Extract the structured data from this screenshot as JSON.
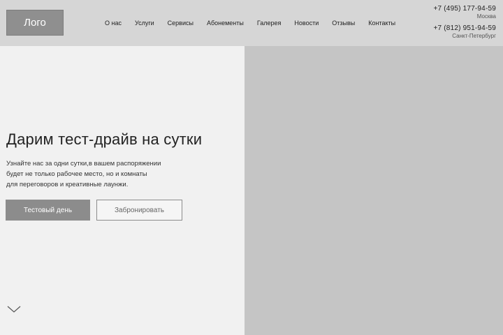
{
  "header": {
    "logo": "Лого",
    "nav": [
      "О нас",
      "Услуги",
      "Сервисы",
      "Абонементы",
      "Галерея",
      "Новости",
      "Отзывы",
      "Контакты"
    ],
    "contacts": [
      {
        "phone": "+7 (495) 177-94-59",
        "city": "Москва"
      },
      {
        "phone": "+7 (812) 951-94-59",
        "city": "Санкт-Петербург"
      }
    ]
  },
  "hero": {
    "title": "Дарим тест-драйв на сутки",
    "text_lines": [
      "Узнайте нас за одни сутки,в вашем распоряжении",
      "будет не только рабочее место, но и комнаты",
      "для переговоров и креативные лаунжи."
    ],
    "primary_button": "Тестовый день",
    "secondary_button": "Забронировать"
  },
  "icons": {
    "scroll_down": "chevron-down-icon"
  },
  "colors": {
    "header_bg": "#d6d6d6",
    "hero_left_bg": "#f1f1f1",
    "hero_right_bg": "#c5c5c5",
    "logo_bg": "#8f8f8f",
    "primary_button_bg": "#8c8c8c"
  }
}
